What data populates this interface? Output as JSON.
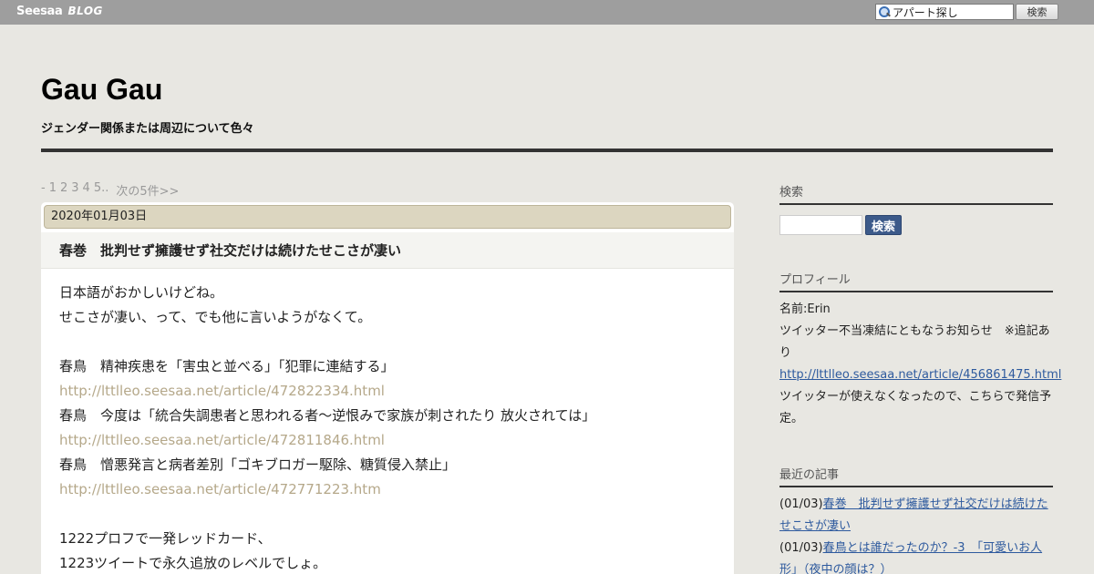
{
  "topbar": {
    "logo_main": "Seesaa",
    "logo_sub": "BLOG",
    "search_value": "アパート探し",
    "search_button": "検索"
  },
  "header": {
    "title": "Gau Gau",
    "description": "ジェンダー関係または周辺について色々"
  },
  "pager": {
    "dash": "-",
    "pages": [
      "1",
      "2",
      "3",
      "4",
      "5.."
    ],
    "next": "次の5件>>"
  },
  "post": {
    "date": "2020年01月03日",
    "title": "春巻　批判せず擁護せず社交だけは続けたせこさが凄い",
    "lines": [
      {
        "text": "日本語がおかしいけどね。",
        "link": false
      },
      {
        "text": "せこさが凄い、って、でも他に言いようがなくて。",
        "link": false
      },
      {
        "text": "",
        "link": false
      },
      {
        "text": "春鳥　精神疾患を「害虫と並べる」「犯罪に連結する」",
        "link": false
      },
      {
        "text": "http://lttlleo.seesaa.net/article/472822334.html",
        "link": true
      },
      {
        "text": "春鳥　今度は「統合失調患者と思われる者～逆恨みで家族が刺されたり 放火されては」",
        "link": false
      },
      {
        "text": "http://lttlleo.seesaa.net/article/472811846.html",
        "link": true
      },
      {
        "text": "春鳥　憎悪発言と病者差別「ゴキブロガー駆除、糖質侵入禁止」",
        "link": false
      },
      {
        "text": "http://lttlleo.seesaa.net/article/472771223.htm",
        "link": true
      },
      {
        "text": "",
        "link": false
      },
      {
        "text": "1222プロフで一発レッドカード、",
        "link": false
      },
      {
        "text": "1223ツイートで永久追放のレベルでしょ。",
        "link": false
      }
    ]
  },
  "sidebar": {
    "search_heading": "検索",
    "search_button": "検索",
    "profile_heading": "プロフィール",
    "profile_name": "名前:Erin",
    "profile_notice": "ツイッター不当凍結にともなうお知らせ　※追記あり",
    "profile_link": "http://lttlleo.seesaa.net/article/456861475.html",
    "profile_note": "ツイッターが使えなくなったので、こちらで発信予定。",
    "recent_heading": "最近の記事",
    "recent": [
      {
        "date": "(01/03)",
        "title": "春巻　批判せず擁護せず社交だけは続けたせこさが凄い"
      },
      {
        "date": "(01/03)",
        "title": "春鳥とは誰だったのか？-3　「可愛いお人形」（夜中の顔は？）"
      }
    ]
  },
  "colors": {
    "page_bg": "#e8e7e2",
    "topbar_bg": "#9e9e9e",
    "date_bar_bg": "#dcd6c0",
    "link_muted": "#b5a88a",
    "link_blue": "#2e5a9e",
    "search_button_bg": "#3c5a8a"
  }
}
